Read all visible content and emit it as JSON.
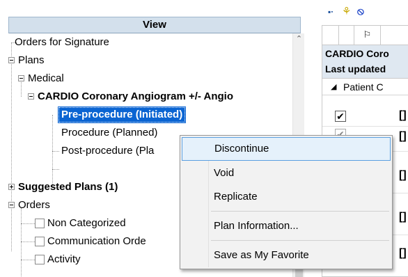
{
  "view_panel": {
    "title": "View",
    "tree": {
      "orders_for_signature": "Orders for Signature",
      "plans": "Plans",
      "medical": "Medical",
      "cardio_plan": "CARDIO Coronary Angiogram +/- Angio",
      "pre_procedure": "Pre-procedure (Initiated)",
      "procedure": "Procedure (Planned)",
      "post_procedure": "Post-procedure (Pla",
      "suggested_plans": "Suggested Plans (1)",
      "orders": "Orders",
      "non_categorized": "Non Categorized",
      "communication_orders": "Communication Orde",
      "activity": "Activity"
    }
  },
  "right_panel": {
    "toolbar_icons": [
      "grid-menu-icon",
      "lightbulb-icon",
      "no-entry-icon"
    ],
    "header_flag_icon": "flag-icon",
    "band_line_1": "CARDIO Coro",
    "band_line_2": "Last updated",
    "group_label": "Patient C",
    "rows": [
      {
        "checked": true,
        "text": "[]"
      },
      {
        "checked": true,
        "text": "[]"
      },
      {
        "checked": false,
        "text": "[]"
      },
      {
        "checked": false,
        "text": "[]"
      },
      {
        "checked": false,
        "text": "[]"
      }
    ]
  },
  "context_menu": {
    "items": [
      {
        "label": "Discontinue",
        "highlighted": true
      },
      {
        "label": "Void",
        "highlighted": false
      },
      {
        "label": "Replicate",
        "highlighted": false
      },
      {
        "label": "Plan Information...",
        "highlighted": false
      },
      {
        "label": "Save as My Favorite",
        "highlighted": false
      }
    ]
  },
  "colors": {
    "header_bg": "#d3e0ec",
    "selection": "#0a64d2",
    "menu_hover_bg": "#e5f1fb",
    "menu_hover_border": "#5a9fe0"
  }
}
